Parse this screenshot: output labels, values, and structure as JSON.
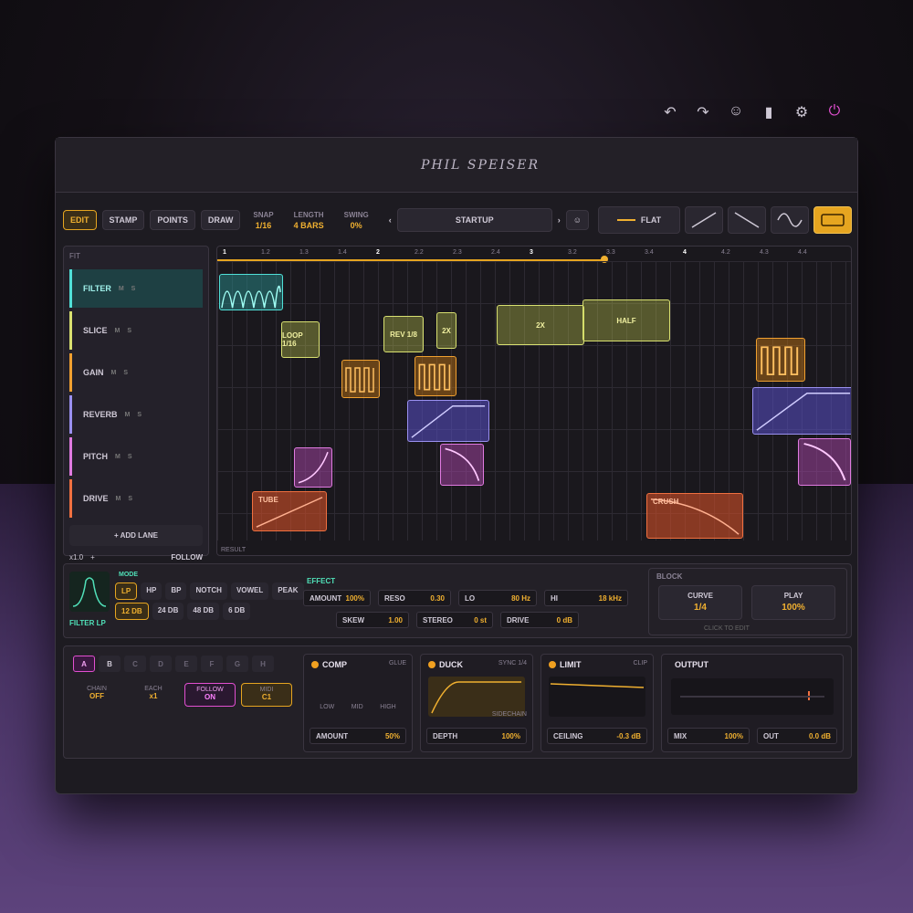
{
  "brand": "PHIL SPEISER",
  "toolbar": {
    "modes": [
      "EDIT",
      "STAMP",
      "POINTS",
      "DRAW"
    ],
    "snap_label": "SNAP",
    "snap_value": "1/16",
    "length_label": "LENGTH",
    "length_value": "4 BARS",
    "swing_label": "SWING",
    "swing_value": "0%",
    "preset": "STARTUP",
    "shape_flat": "FLAT"
  },
  "ruler": [
    "1",
    "1.2",
    "1.3",
    "1.4",
    "2",
    "2.2",
    "2.3",
    "2.4",
    "3",
    "3.2",
    "3.3",
    "3.4",
    "4",
    "4.2",
    "4.3",
    "4.4"
  ],
  "lanes": {
    "fit": "FIT",
    "items": [
      {
        "name": "FILTER",
        "color": "#50e0d8"
      },
      {
        "name": "SLICE",
        "color": "#d8e070"
      },
      {
        "name": "GAIN",
        "color": "#f0a030"
      },
      {
        "name": "REVERB",
        "color": "#9a90f0"
      },
      {
        "name": "PITCH",
        "color": "#e07ae0"
      },
      {
        "name": "DRIVE",
        "color": "#f07040"
      }
    ],
    "m": "M",
    "s": "S",
    "add": "+ ADD LANE",
    "zoom": "x1.0",
    "plus": "+",
    "follow": "FOLLOW"
  },
  "blocks": {
    "loop": "LOOP 1/16",
    "rev": "REV 1/8",
    "twox_small": "2X",
    "twox": "2X",
    "half": "HALF",
    "tube": "TUBE",
    "crush": "CRUSH",
    "result": "RESULT"
  },
  "filter": {
    "label": "FILTER LP",
    "mode_label": "MODE",
    "modes": [
      "LP",
      "HP",
      "BP",
      "NOTCH",
      "VOWEL",
      "PEAK"
    ],
    "slopes": [
      "12 DB",
      "24 DB",
      "48 DB",
      "6 DB"
    ],
    "effect_label": "EFFECT",
    "amount_l": "AMOUNT",
    "amount_v": "100%",
    "reso_l": "RESO",
    "reso_v": "0.30",
    "lo_l": "LO",
    "lo_v": "80 Hz",
    "hi_l": "HI",
    "hi_v": "18 kHz",
    "skew_l": "SKEW",
    "skew_v": "1.00",
    "stereo_l": "STEREO",
    "stereo_v": "0 st",
    "drive_l": "DRIVE",
    "drive_v": "0 dB",
    "block_label": "BLOCK",
    "curve_l": "CURVE",
    "curve_v": "1/4",
    "play_l": "PLAY",
    "play_v": "100%",
    "click_edit": "CLICK TO EDIT"
  },
  "bottom": {
    "slots": [
      "A",
      "B",
      "C",
      "D",
      "E",
      "F",
      "G",
      "H"
    ],
    "chain_l": "CHAIN",
    "chain_v": "OFF",
    "each_l": "EACH",
    "each_v": "x1",
    "follow_l": "FOLLOW",
    "follow_v": "ON",
    "midi_l": "MIDI",
    "midi_v": "C1",
    "comp": {
      "title": "COMP",
      "tag": "GLUE",
      "low": "LOW",
      "mid": "MID",
      "high": "HIGH",
      "p_l": "AMOUNT",
      "p_v": "50%"
    },
    "duck": {
      "title": "DUCK",
      "tag": "SYNC 1/4",
      "side": "SIDECHAIN",
      "p_l": "DEPTH",
      "p_v": "100%"
    },
    "limit": {
      "title": "LIMIT",
      "tag": "CLIP",
      "p_l": "CEILING",
      "p_v": "-0.3 dB"
    },
    "output": {
      "title": "OUTPUT",
      "mix_l": "MIX",
      "mix_v": "100%",
      "out_l": "OUT",
      "out_v": "0.0 dB"
    }
  }
}
